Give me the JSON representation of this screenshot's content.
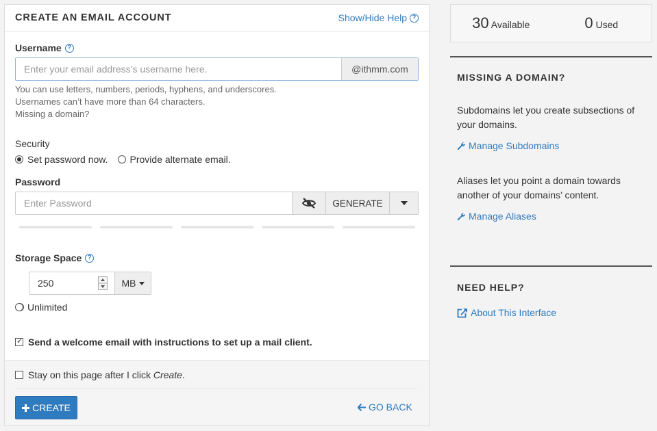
{
  "form": {
    "title": "CREATE AN EMAIL ACCOUNT",
    "help_toggle": "Show/Hide Help",
    "username": {
      "label": "Username",
      "placeholder": "Enter your email address’s username here.",
      "value": "",
      "domain_suffix": "@ithmm.com",
      "hint_line1": "You can use letters, numbers, periods, hyphens, and underscores.",
      "hint_line2": "Usernames can’t have more than 64 characters.",
      "missing_domain_link": "Missing a domain?"
    },
    "security": {
      "label": "Security",
      "option_set_password": "Set password now.",
      "option_alternate_email": "Provide alternate email.",
      "selected": "set_password"
    },
    "password": {
      "label": "Password",
      "placeholder": "Enter Password",
      "generate_label": "GENERATE"
    },
    "storage": {
      "label": "Storage Space",
      "value": "250",
      "unit": "MB",
      "unlimited_label": "Unlimited",
      "selected": "custom"
    },
    "welcome_email": {
      "label": "Send a welcome email with instructions to set up a mail client.",
      "checked": true
    },
    "stay_on_page": {
      "label_prefix": "Stay on this page after I click ",
      "label_emph": "Create",
      "label_suffix": ".",
      "checked": false
    },
    "create_label": "CREATE",
    "go_back_label": "GO BACK"
  },
  "sidebar": {
    "available_count": "30",
    "available_label": "Available",
    "used_count": "0",
    "used_label": "Used",
    "missing_domain": {
      "heading": "MISSING A DOMAIN?",
      "subdomains_text": "Subdomains let you create subsections of your domains.",
      "subdomains_link": "Manage Subdomains",
      "aliases_text": "Aliases let you point a domain towards another of your domains’ content.",
      "aliases_link": "Manage Aliases"
    },
    "need_help": {
      "heading": "NEED HELP?",
      "about_link": "About This Interface"
    }
  },
  "colors": {
    "accent": "#2f7bbf",
    "text": "#333333",
    "background": "#f3f3f3"
  },
  "icons": [
    "question-icon",
    "eye-slash-icon",
    "caret-down-icon",
    "spinner-icon",
    "plus-icon",
    "arrow-left-icon",
    "wrench-icon",
    "external-link-icon"
  ]
}
